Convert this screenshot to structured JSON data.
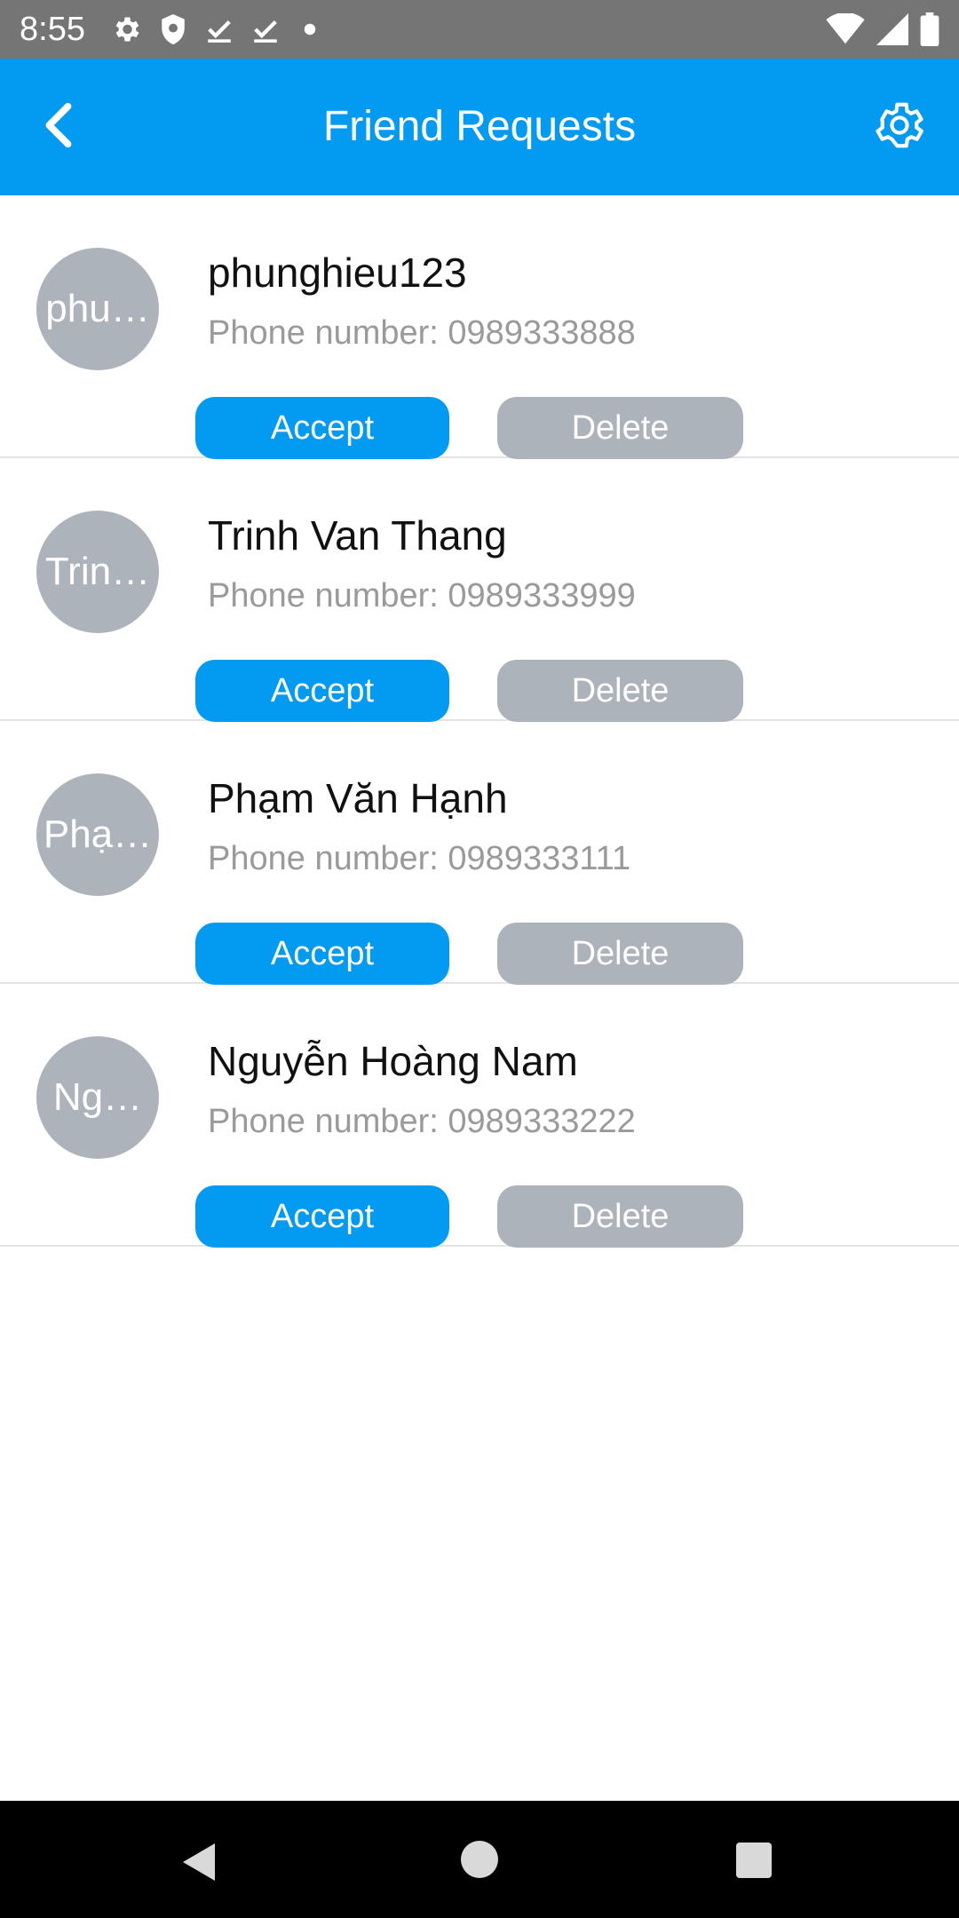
{
  "status_bar": {
    "time": "8:55",
    "icons_left": [
      "gear-icon",
      "shield-icon",
      "download-done-icon",
      "download-done-icon",
      "dot-icon"
    ],
    "icons_right": [
      "wifi-icon",
      "cell-signal-icon",
      "battery-icon"
    ]
  },
  "header": {
    "title": "Friend Requests",
    "back_icon": "chevron-left-icon",
    "settings_icon": "gear-icon",
    "background": "#039BF2"
  },
  "requests": [
    {
      "avatar_text": "phu…",
      "name": "phunghieu123",
      "phone_label": "Phone number: ",
      "phone": "0989333888",
      "accept_label": "Accept",
      "delete_label": "Delete"
    },
    {
      "avatar_text": "Trin…",
      "name": "Trinh Van Thang",
      "phone_label": "Phone number: ",
      "phone": "0989333999",
      "accept_label": "Accept",
      "delete_label": "Delete"
    },
    {
      "avatar_text": "Phạ…",
      "name": "Phạm Văn Hạnh",
      "phone_label": "Phone number: ",
      "phone": "0989333111",
      "accept_label": "Accept",
      "delete_label": "Delete"
    },
    {
      "avatar_text": "Ng…",
      "name": "Nguyễn Hoàng Nam",
      "phone_label": "Phone number: ",
      "phone": "0989333222",
      "accept_label": "Accept",
      "delete_label": "Delete"
    }
  ],
  "colors": {
    "accent": "#039BF2",
    "secondary_button": "#ADB3BB",
    "avatar": "#ADB3BB",
    "phone_text": "#9A9A9A"
  },
  "nav_bar": {
    "icons": [
      "back-triangle-icon",
      "home-circle-icon",
      "recents-square-icon"
    ]
  }
}
